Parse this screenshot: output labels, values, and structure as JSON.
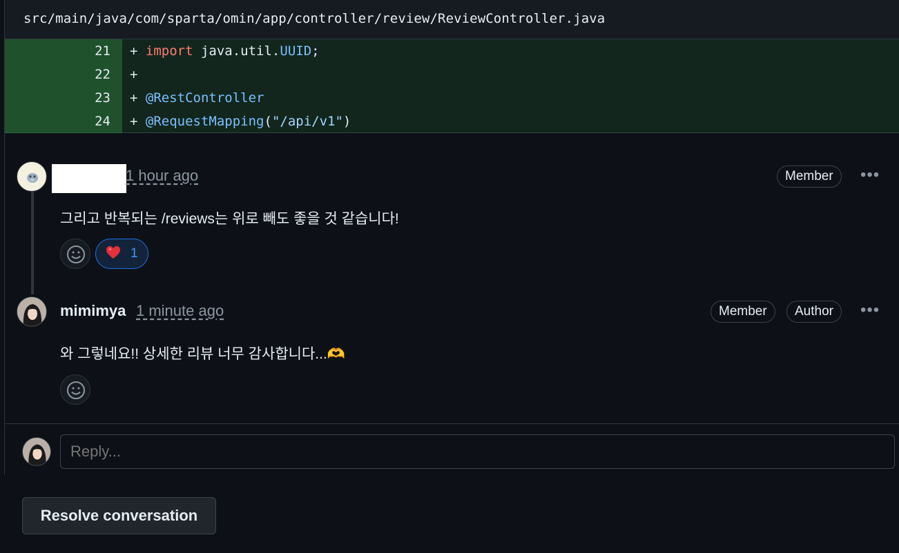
{
  "file": {
    "path": "src/main/java/com/sparta/omin/app/controller/review/ReviewController.java"
  },
  "diff": {
    "lines": [
      {
        "num": "21",
        "prefix": "+ ",
        "kw": "import",
        "rest": " java.util.",
        "type": "UUID",
        "tail": ";"
      },
      {
        "num": "22",
        "prefix": "+",
        "kw": "",
        "rest": "",
        "type": "",
        "tail": ""
      },
      {
        "num": "23",
        "prefix": "+ ",
        "annotation": "@RestController"
      },
      {
        "num": "24",
        "prefix": "+ ",
        "annotation": "@RequestMapping",
        "paren_open": "(",
        "string": "\"/api/v1\"",
        "paren_close": ")"
      }
    ]
  },
  "comments": [
    {
      "author": "",
      "time": "1 hour ago",
      "badges": [
        "Member"
      ],
      "more": "•••",
      "text": "그리고 반복되는 /reviews는 위로 빼도 좋을 것 같습니다!",
      "reaction": {
        "emoji": "❤️",
        "count": "1"
      }
    },
    {
      "author": "mimimya",
      "time": "1 minute ago",
      "badges": [
        "Member",
        "Author"
      ],
      "more": "•••",
      "text": "와 그렇네요!! 상세한 리뷰 너무 감사합니다...🫶"
    }
  ],
  "reply": {
    "placeholder": "Reply..."
  },
  "resolve": {
    "label": "Resolve conversation"
  },
  "colors": {
    "background": "#0d1117",
    "diff_added": "#1f3a28",
    "accent": "#4493f8"
  }
}
